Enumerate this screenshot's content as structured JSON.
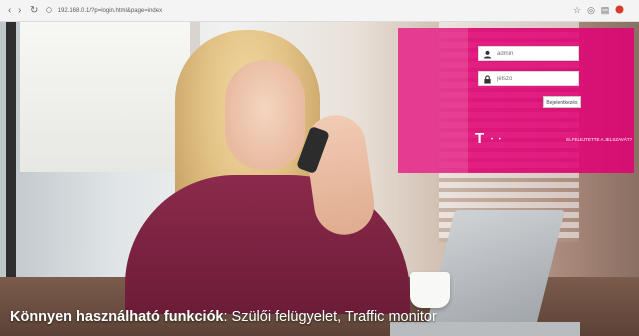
{
  "browser": {
    "back_icon": "back-arrow-icon",
    "forward_icon": "forward-arrow-icon",
    "reload_icon": "reload-icon",
    "url": "192.168.0.1/?p=login.html&page=index",
    "toolbar_icons": [
      "star-icon",
      "extensions-icon",
      "menu-icon",
      "profile-icon"
    ],
    "profile_color": "#d93b2b"
  },
  "login": {
    "username_placeholder": "admin",
    "password_placeholder": "jelszó",
    "submit_label": "Bejelentkezés",
    "forgot_link": "ELFELEJTETTE A JELSZAVÁT?",
    "brand_letter": "T",
    "brand_dots": "• •",
    "panel_color": "#e20074"
  },
  "caption": {
    "bold": "Könnyen használható funkciók",
    "rest": ": Szülői felügyelet, Traffic monitor"
  }
}
